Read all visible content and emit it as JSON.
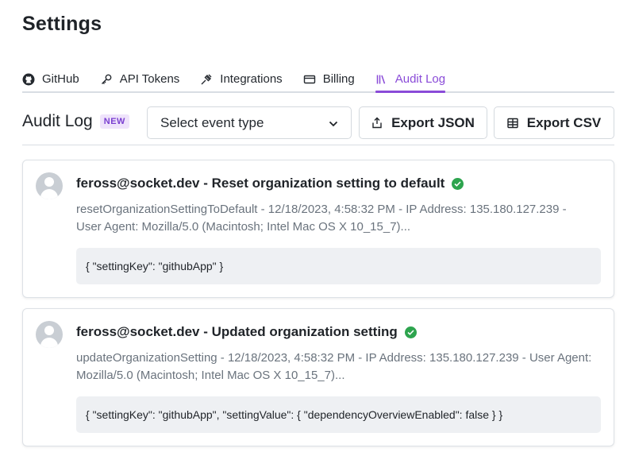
{
  "page": {
    "title": "Settings"
  },
  "tabs": [
    {
      "label": "GitHub",
      "icon": "github-icon",
      "active": false
    },
    {
      "label": "API Tokens",
      "icon": "key-icon",
      "active": false
    },
    {
      "label": "Integrations",
      "icon": "plug-icon",
      "active": false
    },
    {
      "label": "Billing",
      "icon": "credit-card-icon",
      "active": false
    },
    {
      "label": "Audit Log",
      "icon": "library-icon",
      "active": true
    }
  ],
  "toolbar": {
    "section_title": "Audit Log",
    "new_badge": "NEW",
    "select_value": "Select event type",
    "export_json_label": "Export JSON",
    "export_csv_label": "Export CSV"
  },
  "entries": [
    {
      "title": "feross@socket.dev - Reset organization setting to default",
      "meta": "resetOrganizationSettingToDefault - 12/18/2023, 4:58:32 PM - IP Address: 135.180.127.239 - User Agent: Mozilla/5.0 (Macintosh; Intel Mac OS X 10_15_7)...",
      "payload": "{ \"settingKey\": \"githubApp\" }",
      "status": "success"
    },
    {
      "title": "feross@socket.dev - Updated organization setting",
      "meta": "updateOrganizationSetting - 12/18/2023, 4:58:32 PM - IP Address: 135.180.127.239 - User Agent: Mozilla/5.0 (Macintosh; Intel Mac OS X 10_15_7)...",
      "payload": "{ \"settingKey\": \"githubApp\", \"settingValue\": { \"dependencyOverviewEnabled\": false } }",
      "status": "success"
    }
  ],
  "colors": {
    "accent": "#8a4bd8",
    "success": "#2da44e",
    "muted_text": "#6a737d",
    "border": "#d8dde3"
  }
}
